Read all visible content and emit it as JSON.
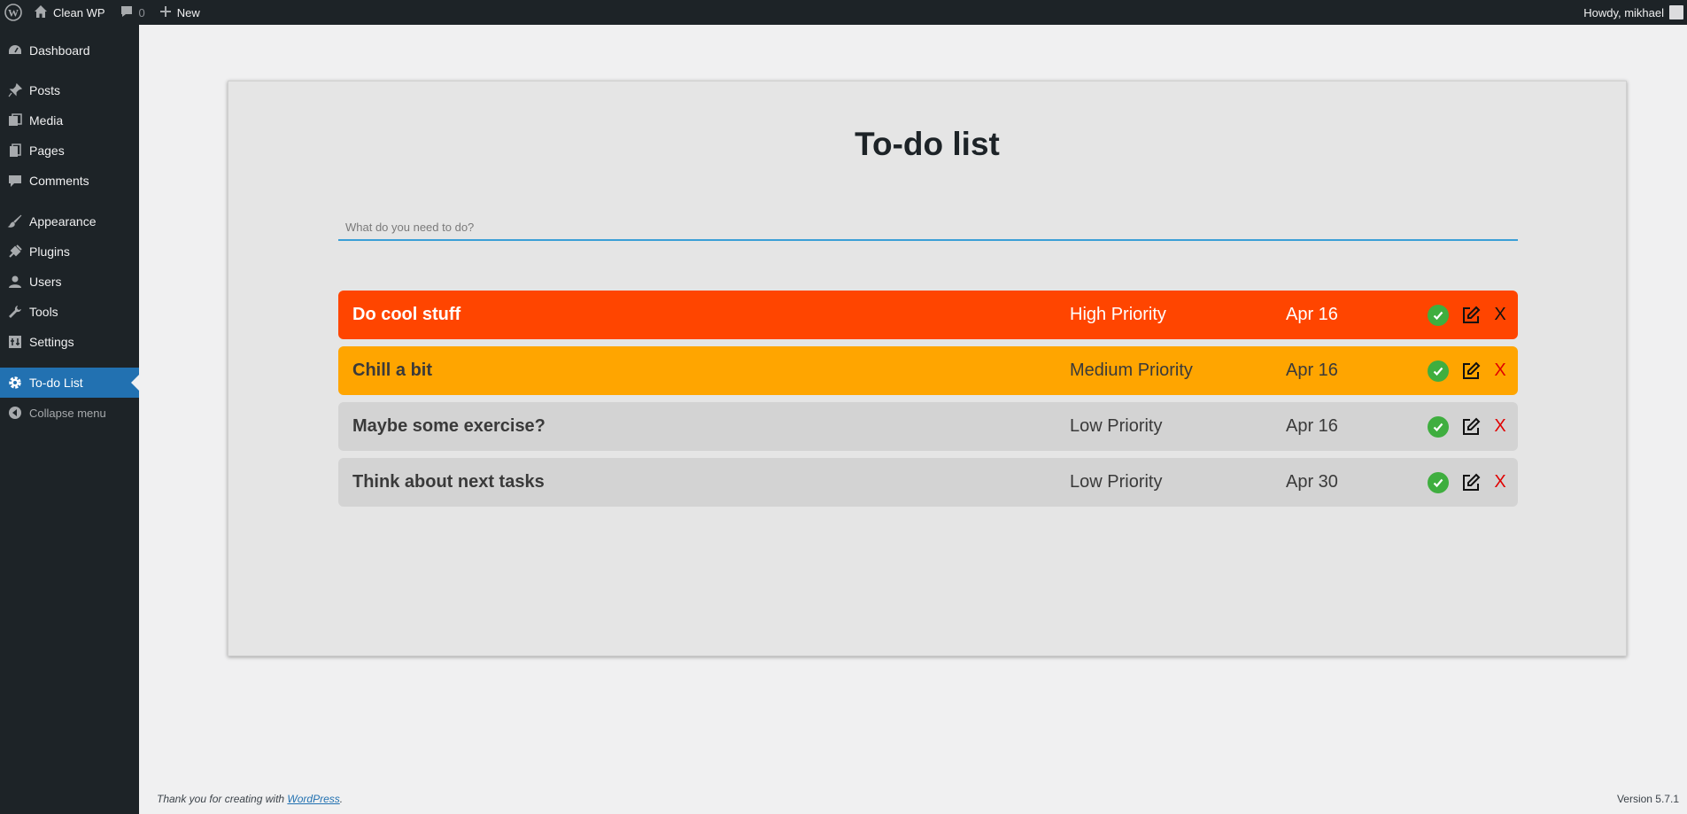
{
  "adminbar": {
    "site_name": "Clean WP",
    "comments_count": "0",
    "new_label": "New",
    "howdy": "Howdy, mikhael"
  },
  "sidebar": {
    "items": [
      {
        "label": "Dashboard",
        "icon": "dashboard-icon"
      },
      {
        "label": "Posts",
        "icon": "pin-icon"
      },
      {
        "label": "Media",
        "icon": "media-icon"
      },
      {
        "label": "Pages",
        "icon": "pages-icon"
      },
      {
        "label": "Comments",
        "icon": "comment-icon"
      },
      {
        "label": "Appearance",
        "icon": "brush-icon"
      },
      {
        "label": "Plugins",
        "icon": "plug-icon"
      },
      {
        "label": "Users",
        "icon": "user-icon"
      },
      {
        "label": "Tools",
        "icon": "wrench-icon"
      },
      {
        "label": "Settings",
        "icon": "settings-icon"
      },
      {
        "label": "To-do List",
        "icon": "gear-icon",
        "current": true
      },
      {
        "label": "Collapse menu",
        "icon": "collapse-icon"
      }
    ]
  },
  "main": {
    "title": "To-do list",
    "input_placeholder": "What do you need to do?",
    "tasks": [
      {
        "name": "Do cool stuff",
        "priority": "High Priority",
        "date": "Apr 16",
        "delete": "X"
      },
      {
        "name": "Chill a bit",
        "priority": "Medium Priority",
        "date": "Apr 16",
        "delete": "X"
      },
      {
        "name": "Maybe some exercise?",
        "priority": "Low Priority",
        "date": "Apr 16",
        "delete": "X"
      },
      {
        "name": "Think about next tasks",
        "priority": "Low Priority",
        "date": "Apr 30",
        "delete": "X"
      }
    ]
  },
  "footer": {
    "thanks_prefix": "Thank you for creating with ",
    "thanks_link": "WordPress",
    "thanks_suffix": ".",
    "version": "Version 5.7.1"
  },
  "colors": {
    "high": "#ff4500",
    "medium": "#ffa500",
    "low": "#d3d3d3",
    "accent": "#2271b1"
  }
}
